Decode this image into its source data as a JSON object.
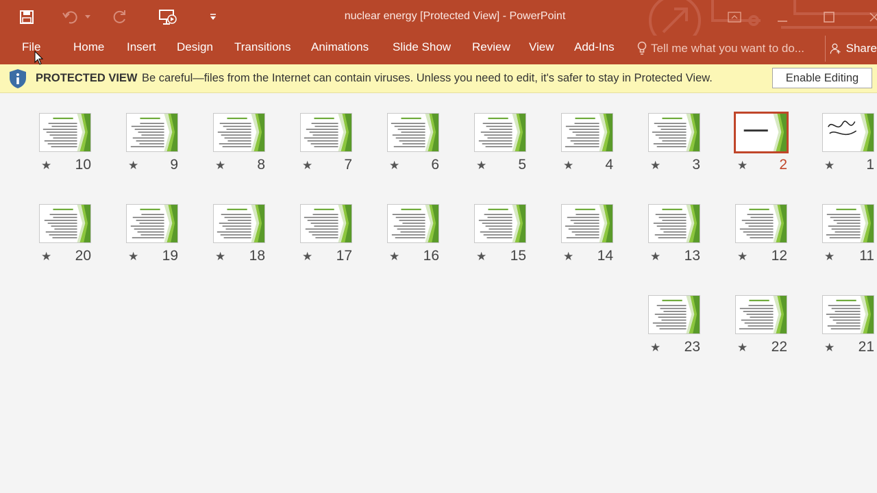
{
  "window": {
    "title": "nuclear energy [Protected View] - PowerPoint",
    "brand_color": "#b7472a"
  },
  "quick_access": {
    "save_icon": "save-icon",
    "undo_icon": "undo-icon",
    "redo_icon": "redo-icon",
    "present_icon": "start-from-beginning-icon",
    "customize_icon": "customize-quick-access-icon"
  },
  "ribbon": {
    "tabs": [
      "File",
      "Home",
      "Insert",
      "Design",
      "Transitions",
      "Animations",
      "Slide Show",
      "Review",
      "View",
      "Add-Ins"
    ],
    "tell_me": "Tell me what you want to do...",
    "share": "Share"
  },
  "protected_view": {
    "label": "PROTECTED VIEW",
    "message": "Be careful—files from the Internet can contain viruses. Unless you need to edit, it's safer to stay in Protected View.",
    "button": "Enable Editing"
  },
  "slides": [
    {
      "number": "1",
      "title_style": "calligraphy"
    },
    {
      "number": "2",
      "title_style": "title",
      "selected": true
    },
    {
      "number": "3",
      "title_style": "text"
    },
    {
      "number": "4",
      "title_style": "text"
    },
    {
      "number": "5",
      "title_style": "text"
    },
    {
      "number": "6",
      "title_style": "text"
    },
    {
      "number": "7",
      "title_style": "text"
    },
    {
      "number": "8",
      "title_style": "text"
    },
    {
      "number": "9",
      "title_style": "text"
    },
    {
      "number": "10",
      "title_style": "text"
    },
    {
      "number": "11",
      "title_style": "text"
    },
    {
      "number": "12",
      "title_style": "text"
    },
    {
      "number": "13",
      "title_style": "text"
    },
    {
      "number": "14",
      "title_style": "text"
    },
    {
      "number": "15",
      "title_style": "text"
    },
    {
      "number": "16",
      "title_style": "text"
    },
    {
      "number": "17",
      "title_style": "text"
    },
    {
      "number": "18",
      "title_style": "text"
    },
    {
      "number": "19",
      "title_style": "text"
    },
    {
      "number": "20",
      "title_style": "text"
    },
    {
      "number": "21",
      "title_style": "text"
    },
    {
      "number": "22",
      "title_style": "text"
    },
    {
      "number": "23",
      "title_style": "text"
    }
  ]
}
